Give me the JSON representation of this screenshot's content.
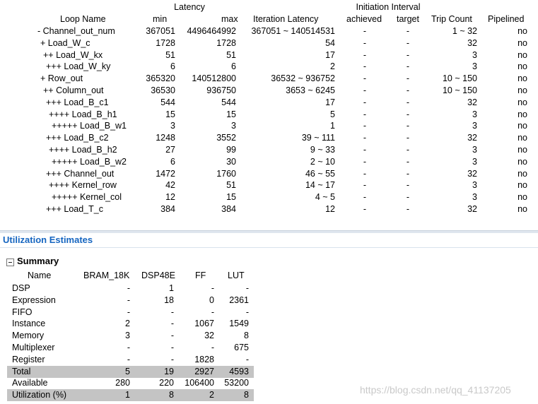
{
  "loop_table": {
    "group_headers": {
      "latency": "Latency",
      "interval": "Initiation Interval"
    },
    "headers": {
      "loop_name": "Loop Name",
      "min": "min",
      "max": "max",
      "iteration_latency": "Iteration Latency",
      "achieved": "achieved",
      "target": "target",
      "trip_count": "Trip Count",
      "pipelined": "Pipelined"
    },
    "rows": [
      {
        "name": "- Channel_out_num",
        "min": "367051",
        "max": "4496464992",
        "iter": "367051 ~ 140514531",
        "achieved": "-",
        "target": "-",
        "trip": "1 ~ 32",
        "pipelined": "no"
      },
      {
        "name": "+ Load_W_c",
        "min": "1728",
        "max": "1728",
        "iter": "54",
        "achieved": "-",
        "target": "-",
        "trip": "32",
        "pipelined": "no"
      },
      {
        "name": "++ Load_W_kx",
        "min": "51",
        "max": "51",
        "iter": "17",
        "achieved": "-",
        "target": "-",
        "trip": "3",
        "pipelined": "no"
      },
      {
        "name": "+++ Load_W_ky",
        "min": "6",
        "max": "6",
        "iter": "2",
        "achieved": "-",
        "target": "-",
        "trip": "3",
        "pipelined": "no"
      },
      {
        "name": "+ Row_out",
        "min": "365320",
        "max": "140512800",
        "iter": "36532 ~ 936752",
        "achieved": "-",
        "target": "-",
        "trip": "10 ~ 150",
        "pipelined": "no"
      },
      {
        "name": "++ Column_out",
        "min": "36530",
        "max": "936750",
        "iter": "3653 ~ 6245",
        "achieved": "-",
        "target": "-",
        "trip": "10 ~ 150",
        "pipelined": "no"
      },
      {
        "name": "+++ Load_B_c1",
        "min": "544",
        "max": "544",
        "iter": "17",
        "achieved": "-",
        "target": "-",
        "trip": "32",
        "pipelined": "no"
      },
      {
        "name": "++++ Load_B_h1",
        "min": "15",
        "max": "15",
        "iter": "5",
        "achieved": "-",
        "target": "-",
        "trip": "3",
        "pipelined": "no"
      },
      {
        "name": "+++++ Load_B_w1",
        "min": "3",
        "max": "3",
        "iter": "1",
        "achieved": "-",
        "target": "-",
        "trip": "3",
        "pipelined": "no"
      },
      {
        "name": "+++ Load_B_c2",
        "min": "1248",
        "max": "3552",
        "iter": "39 ~ 111",
        "achieved": "-",
        "target": "-",
        "trip": "32",
        "pipelined": "no"
      },
      {
        "name": "++++ Load_B_h2",
        "min": "27",
        "max": "99",
        "iter": "9 ~ 33",
        "achieved": "-",
        "target": "-",
        "trip": "3",
        "pipelined": "no"
      },
      {
        "name": "+++++ Load_B_w2",
        "min": "6",
        "max": "30",
        "iter": "2 ~ 10",
        "achieved": "-",
        "target": "-",
        "trip": "3",
        "pipelined": "no"
      },
      {
        "name": "+++ Channel_out",
        "min": "1472",
        "max": "1760",
        "iter": "46 ~ 55",
        "achieved": "-",
        "target": "-",
        "trip": "32",
        "pipelined": "no"
      },
      {
        "name": "++++ Kernel_row",
        "min": "42",
        "max": "51",
        "iter": "14 ~ 17",
        "achieved": "-",
        "target": "-",
        "trip": "3",
        "pipelined": "no"
      },
      {
        "name": "+++++ Kernel_col",
        "min": "12",
        "max": "15",
        "iter": "4 ~ 5",
        "achieved": "-",
        "target": "-",
        "trip": "3",
        "pipelined": "no"
      },
      {
        "name": "+++ Load_T_c",
        "min": "384",
        "max": "384",
        "iter": "12",
        "achieved": "-",
        "target": "-",
        "trip": "32",
        "pipelined": "no"
      }
    ]
  },
  "utilization": {
    "section_title": "Utilization Estimates",
    "summary_title": "Summary",
    "headers": {
      "name": "Name",
      "bram": "BRAM_18K",
      "dsp": "DSP48E",
      "ff": "FF",
      "lut": "LUT"
    },
    "rows": [
      {
        "name": "DSP",
        "bram": "-",
        "dsp": "1",
        "ff": "-",
        "lut": "-",
        "shaded": false
      },
      {
        "name": "Expression",
        "bram": "-",
        "dsp": "18",
        "ff": "0",
        "lut": "2361",
        "shaded": false
      },
      {
        "name": "FIFO",
        "bram": "-",
        "dsp": "-",
        "ff": "-",
        "lut": "-",
        "shaded": false
      },
      {
        "name": "Instance",
        "bram": "2",
        "dsp": "-",
        "ff": "1067",
        "lut": "1549",
        "shaded": false
      },
      {
        "name": "Memory",
        "bram": "3",
        "dsp": "-",
        "ff": "32",
        "lut": "8",
        "shaded": false
      },
      {
        "name": "Multiplexer",
        "bram": "-",
        "dsp": "-",
        "ff": "-",
        "lut": "675",
        "shaded": false
      },
      {
        "name": "Register",
        "bram": "-",
        "dsp": "-",
        "ff": "1828",
        "lut": "-",
        "shaded": false
      },
      {
        "name": "Total",
        "bram": "5",
        "dsp": "19",
        "ff": "2927",
        "lut": "4593",
        "shaded": true
      },
      {
        "name": "Available",
        "bram": "280",
        "dsp": "220",
        "ff": "106400",
        "lut": "53200",
        "shaded": false
      },
      {
        "name": "Utilization (%)",
        "bram": "1",
        "dsp": "8",
        "ff": "2",
        "lut": "8",
        "shaded": true
      }
    ]
  },
  "watermark": "https://blog.csdn.net/qq_41137205",
  "colors": {
    "section_title": "#1565c0",
    "shaded_row": "#c4c4c4"
  }
}
